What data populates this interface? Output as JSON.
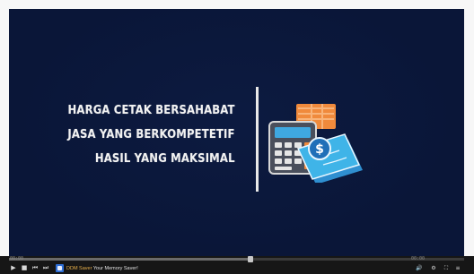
{
  "video": {
    "headline_lines": [
      "HARGA CETAK BERSAHABAT",
      "JASA YANG BERKOMPETETIF",
      "HASIL YANG MAKSIMAL"
    ],
    "background_color": "#0a1638",
    "accent_colors": {
      "calculator_body": "#4a4f5c",
      "calculator_screen": "#3fa8e0",
      "paper_stack": "#f08a3c",
      "money_note": "#3fb4e8"
    },
    "illustration_icons": [
      "calculator-icon",
      "money-stack-icon",
      "dollar-coin-icon"
    ]
  },
  "player": {
    "progress_fraction": 0.53,
    "time_elapsed": "00:00",
    "time_total": "00:00",
    "buttons": {
      "play": "▶",
      "stop": "■",
      "prev": "⏮",
      "next": "⏭",
      "volume": "🔊",
      "settings": "⚙",
      "fullscreen": "⛶",
      "menu": "≡"
    },
    "ticker": {
      "brand": "DDM Saver",
      "tagline": " Your Memory Saver!"
    }
  }
}
